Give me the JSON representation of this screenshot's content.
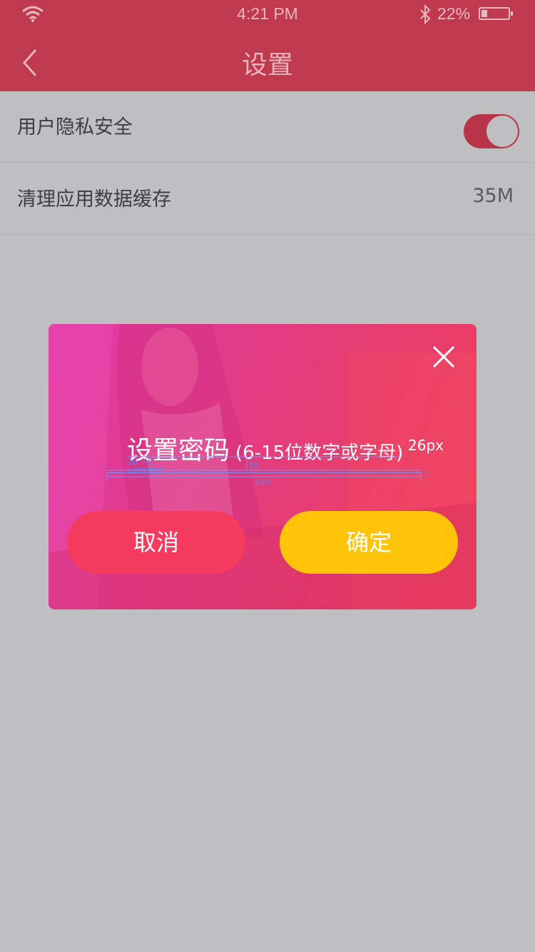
{
  "status_bar": {
    "time": "4:21 PM",
    "battery_percent": "22%",
    "battery_level": 0.22,
    "icons": [
      "wifi-icon",
      "bluetooth-icon",
      "battery-icon"
    ]
  },
  "nav": {
    "title": "设置",
    "back_icon": "chevron-left-icon"
  },
  "settings": {
    "privacy": {
      "label": "用户隐私安全",
      "toggle_on": true
    },
    "cache": {
      "label": "清理应用数据缓存",
      "value": "35M"
    }
  },
  "dialog": {
    "title": "设置密码",
    "hint": "(6-15位数字或字母)",
    "hint_size_note": "26px",
    "annotations": {
      "font_size": "36 PX",
      "color": "#FFFFFF",
      "gap": "20",
      "width": "440",
      "line_height": "1"
    },
    "cancel_label": "取消",
    "confirm_label": "确定",
    "close_icon": "close-icon"
  },
  "colors": {
    "header": "#c03a4f",
    "background": "#bfbfc1",
    "cancel": "#f53c5f",
    "confirm": "#fec40a",
    "dialog_gradient_start": "#e33aa7",
    "dialog_gradient_end": "#ee3f5c"
  }
}
